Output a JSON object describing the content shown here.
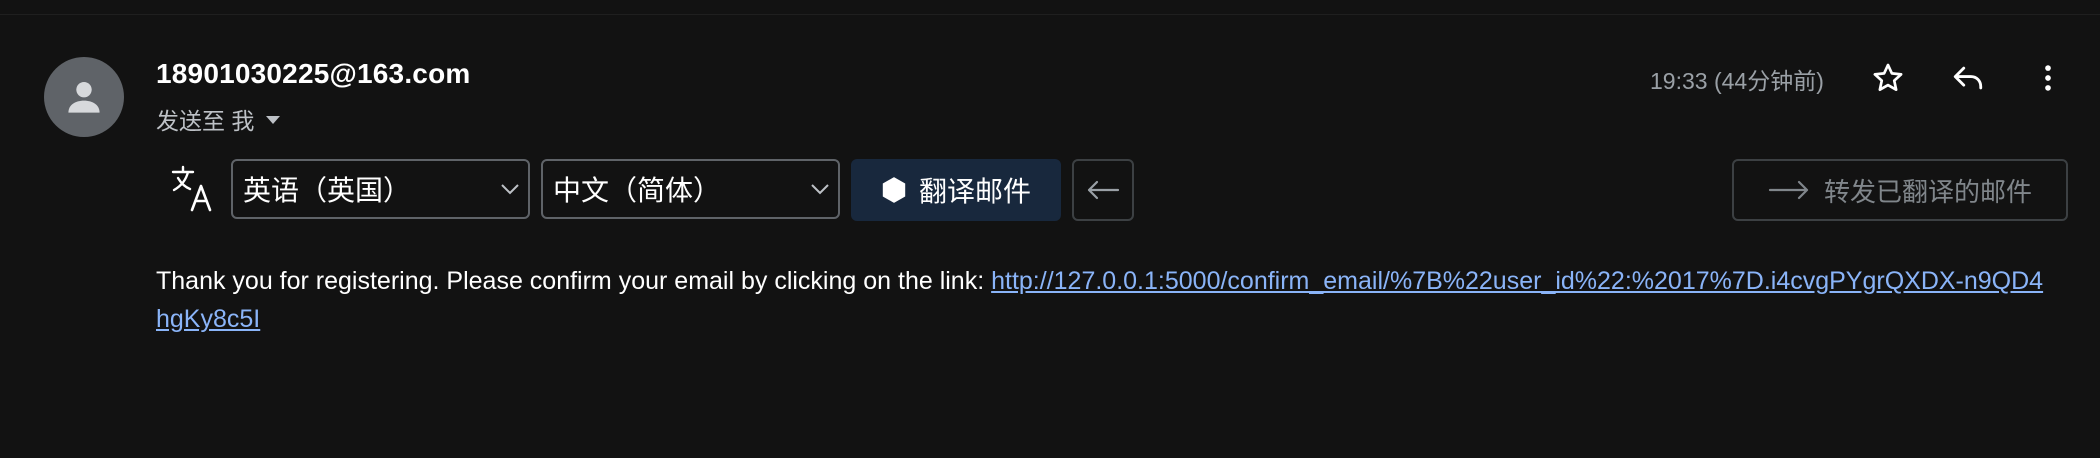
{
  "header": {
    "sender": "18901030225@163.com",
    "recipient_prefix": "发送至 我",
    "time": "19:33 (44分钟前)"
  },
  "actions": {
    "star": "star-icon",
    "reply": "reply-icon",
    "more": "more-vert-icon"
  },
  "translate_bar": {
    "source_language": "英语（英国）",
    "target_language": "中文（简体）",
    "translate_button": "翻译邮件",
    "forward_button": "转发已翻译的邮件"
  },
  "message": {
    "text": "Thank you for registering. Please confirm your email by clicking on the link: ",
    "link": "http://127.0.0.1:5000/confirm_email/%7B%22user_id%22:%2017%7D.i4cvgPYgrQXDX-n9QD4hgKy8c5I"
  },
  "colors": {
    "background": "#121212",
    "link": "#8ab4f8",
    "translate_button_bg": "#18283d"
  }
}
